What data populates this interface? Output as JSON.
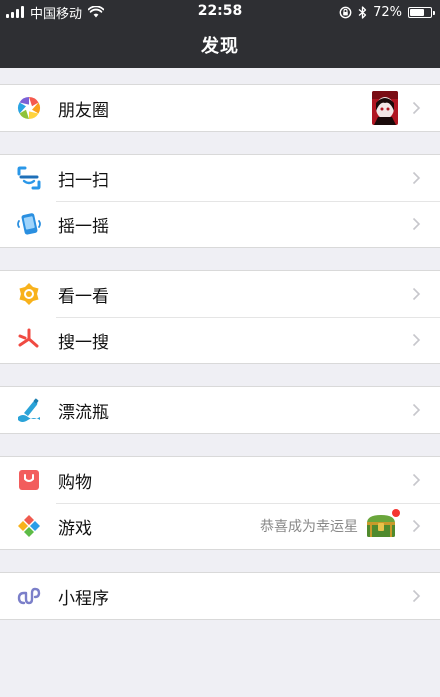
{
  "status_bar": {
    "carrier": "中国移动",
    "time": "22:58",
    "battery": "72%",
    "battery_level": 0.72
  },
  "header": {
    "title": "发现"
  },
  "groups": [
    {
      "items": [
        {
          "label": "朋友圈",
          "icon": "moments-icon",
          "has_thumbnail": true
        }
      ]
    },
    {
      "items": [
        {
          "label": "扫一扫",
          "icon": "scan-icon"
        },
        {
          "label": "摇一摇",
          "icon": "shake-icon"
        }
      ]
    },
    {
      "items": [
        {
          "label": "看一看",
          "icon": "top-stories-icon"
        },
        {
          "label": "搜一搜",
          "icon": "search-icon"
        }
      ]
    },
    {
      "items": [
        {
          "label": "漂流瓶",
          "icon": "drift-bottle-icon"
        }
      ]
    },
    {
      "items": [
        {
          "label": "购物",
          "icon": "shopping-icon"
        },
        {
          "label": "游戏",
          "icon": "games-icon",
          "subtitle": "恭喜成为幸运星",
          "has_badge": true
        }
      ]
    },
    {
      "items": [
        {
          "label": "小程序",
          "icon": "mini-programs-icon"
        }
      ]
    }
  ],
  "colors": {
    "header_bg": "#2e2f33",
    "page_bg": "#efeff4",
    "badge": "#f43530"
  }
}
